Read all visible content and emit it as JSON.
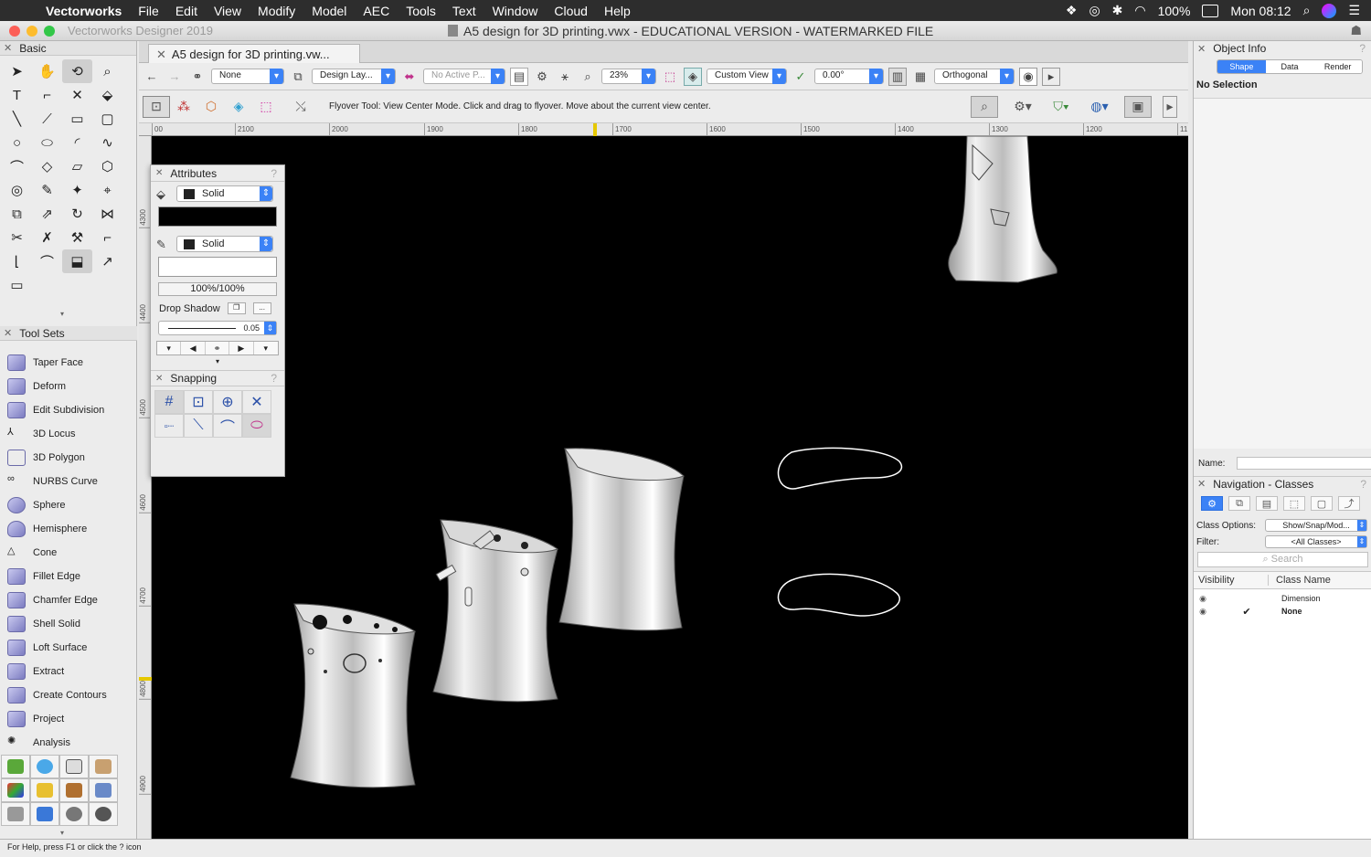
{
  "menubar": {
    "app_name": "Vectorworks",
    "items": [
      "File",
      "Edit",
      "View",
      "Modify",
      "Model",
      "AEC",
      "Tools",
      "Text",
      "Window",
      "Cloud",
      "Help"
    ],
    "battery": "100%",
    "clock": "Mon 08:12"
  },
  "window": {
    "app_subtitle": "Vectorworks Designer 2019",
    "title": "A5 design for 3D printing.vwx - EDUCATIONAL VERSION - WATERMARKED FILE",
    "tab_label": "A5 design for 3D printing.vw..."
  },
  "left_panel": {
    "basic_title": "Basic",
    "toolsets_title": "Tool Sets",
    "toolset_items": [
      "Taper Face",
      "Deform",
      "Edit Subdivision",
      "3D Locus",
      "3D Polygon",
      "NURBS Curve",
      "Sphere",
      "Hemisphere",
      "Cone",
      "Fillet Edge",
      "Chamfer Edge",
      "Shell Solid",
      "Loft Surface",
      "Extract",
      "Create Contours",
      "Project",
      "Analysis"
    ]
  },
  "viewbar": {
    "saved_views": "None",
    "layer": "Design Lay...",
    "active_plane": "No Active P...",
    "zoom": "23%",
    "view": "Custom View",
    "rotation": "0.00°",
    "projection": "Orthogonal"
  },
  "modebar": {
    "help_text": "Flyover Tool: View Center Mode. Click and drag to flyover.  Move about the current view center."
  },
  "rulers": {
    "top": [
      "00",
      "2100",
      "2000",
      "1900",
      "1800",
      "1700",
      "1600",
      "1500",
      "1400",
      "1300",
      "1200",
      "11"
    ],
    "left": [
      "4300",
      "4400",
      "4500",
      "4600",
      "4700",
      "4800",
      "4900"
    ]
  },
  "attributes": {
    "title": "Attributes",
    "fill_style": "Solid",
    "pen_style": "Solid",
    "opacity": "100%/100%",
    "drop_shadow_label": "Drop Shadow",
    "line_thickness": "0.05",
    "fill_color": "#000000",
    "pen_color": "#ffffff"
  },
  "snapping": {
    "title": "Snapping"
  },
  "object_info": {
    "title": "Object Info",
    "tabs": [
      "Shape",
      "Data",
      "Render"
    ],
    "active_tab": "Shape",
    "status": "No Selection",
    "name_label": "Name:"
  },
  "navigation": {
    "title": "Navigation - Classes",
    "class_options_label": "Class Options:",
    "class_options_value": "Show/Snap/Mod...",
    "filter_label": "Filter:",
    "filter_value": "<All Classes>",
    "search_placeholder": "Search",
    "col_visibility": "Visibility",
    "col_class_name": "Class Name",
    "classes": [
      {
        "name": "Dimension",
        "active": false
      },
      {
        "name": "None",
        "active": true
      }
    ]
  },
  "statusbar": {
    "text": "For Help, press F1 or click the ? icon"
  },
  "colors": {
    "accent": "#3b82f6",
    "canvas_bg": "#000000",
    "ruler_marker": "#e6c800"
  }
}
